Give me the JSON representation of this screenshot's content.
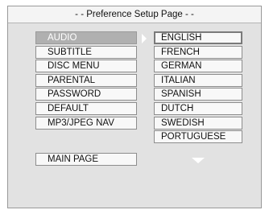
{
  "header": {
    "title": "- - Preference Setup Page - -"
  },
  "menu": {
    "items": [
      {
        "label": "AUDIO",
        "selected": true
      },
      {
        "label": "SUBTITLE"
      },
      {
        "label": "DISC MENU"
      },
      {
        "label": "PARENTAL"
      },
      {
        "label": "PASSWORD"
      },
      {
        "label": "DEFAULT"
      },
      {
        "label": "MP3/JPEG NAV"
      }
    ],
    "main_page_label": "MAIN PAGE"
  },
  "options": {
    "items": [
      {
        "label": "ENGLISH",
        "highlighted": true
      },
      {
        "label": "FRENCH"
      },
      {
        "label": "GERMAN"
      },
      {
        "label": "ITALIAN"
      },
      {
        "label": "SPANISH"
      },
      {
        "label": "DUTCH"
      },
      {
        "label": "SWEDISH"
      },
      {
        "label": "PORTUGUESE"
      }
    ]
  },
  "icons": {
    "submenu": "arrow-right-icon",
    "scroll": "arrow-down-icon"
  },
  "colors": {
    "background": "#e2e2e2",
    "selected": "#b0b0b0",
    "item": "#f8f8f8"
  }
}
